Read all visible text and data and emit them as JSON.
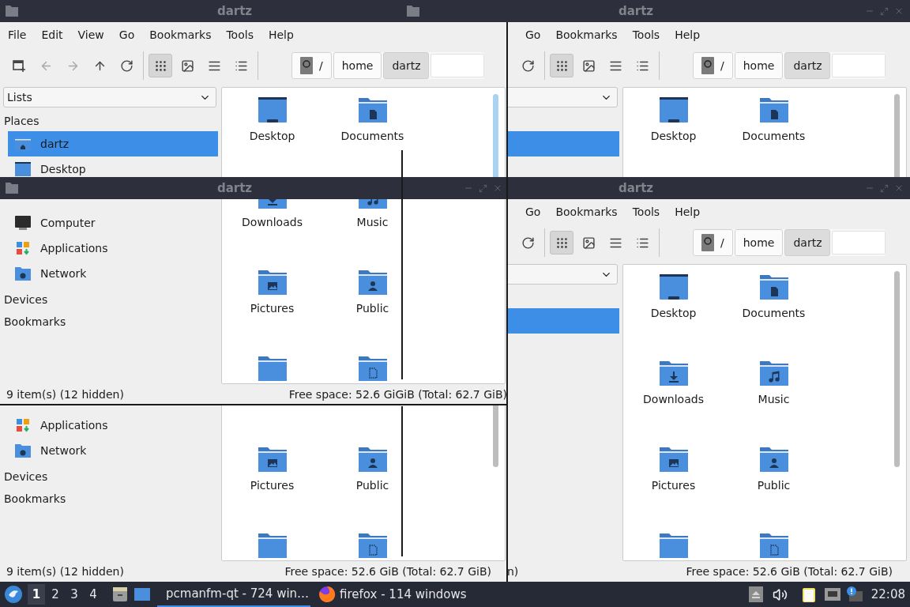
{
  "fragments": [
    {
      "kind": "title_bar",
      "title": "dartz"
    },
    {
      "kind": "title_bar",
      "title": "dartz",
      "window_controls": true
    },
    {
      "kind": "window_body",
      "menu": [
        "File",
        "Edit",
        "View",
        "Go",
        "Bookmarks",
        "Tools",
        "Help"
      ],
      "toolbar": [
        {
          "kind": "new_tab",
          "disabled": false
        },
        {
          "kind": "back",
          "disabled": true
        },
        {
          "kind": "forward",
          "disabled": true
        },
        {
          "kind": "up",
          "disabled": false
        },
        {
          "kind": "reload",
          "disabled": false
        },
        {
          "kind": "separator"
        },
        {
          "kind": "icon_view",
          "selected": true
        },
        {
          "kind": "thumbnail_view",
          "selected": false
        },
        {
          "kind": "compact_view",
          "selected": false
        },
        {
          "kind": "detail_view",
          "selected": false
        },
        {
          "kind": "separator"
        }
      ],
      "path": [
        {
          "kind": "root",
          "label": "/",
          "selected": false
        },
        {
          "kind": "dir",
          "label": "home",
          "selected": false
        },
        {
          "kind": "dir",
          "label": "dartz",
          "selected": true
        }
      ],
      "sidebar": [
        {
          "kind": "dropdown",
          "value": "Lists"
        },
        {
          "kind": "header",
          "label": "Places"
        },
        {
          "kind": "home",
          "label": "dartz",
          "selected": true
        },
        {
          "kind": "desktop",
          "label": "Desktop",
          "selected": false
        }
      ],
      "files": [
        {
          "kind": "desktop",
          "label": "Desktop"
        },
        {
          "kind": "documents",
          "label": "Documents"
        }
      ]
    },
    {
      "kind": "window_body",
      "menu": [
        "Go",
        "Bookmarks",
        "Tools",
        "Help"
      ],
      "toolbar": [
        {
          "kind": "reload",
          "disabled": false
        },
        {
          "kind": "separator"
        },
        {
          "kind": "icon_view",
          "selected": true
        },
        {
          "kind": "thumbnail_view",
          "selected": false
        },
        {
          "kind": "compact_view",
          "selected": false
        },
        {
          "kind": "detail_view",
          "selected": false
        },
        {
          "kind": "separator"
        }
      ],
      "path": [
        {
          "kind": "root",
          "label": "/",
          "selected": false
        },
        {
          "kind": "dir",
          "label": "home",
          "selected": false
        },
        {
          "kind": "dir",
          "label": "dartz",
          "selected": true
        }
      ],
      "sidebar": [
        {
          "kind": "dropdown"
        },
        {
          "kind": "header"
        },
        {
          "kind": "home",
          "selected": true
        }
      ],
      "files": [
        {
          "kind": "desktop",
          "label": "Desktop"
        },
        {
          "kind": "documents",
          "label": "Documents"
        }
      ]
    },
    {
      "kind": "title_bar",
      "title": "dartz",
      "window_controls": true
    },
    {
      "kind": "title_bar",
      "title": "dartz",
      "window_controls": true
    },
    {
      "kind": "window_body",
      "sidebar": [
        {
          "kind": "computer",
          "label": "Computer",
          "selected": false
        },
        {
          "kind": "applications",
          "label": "Applications",
          "selected": false
        },
        {
          "kind": "network",
          "label": "Network",
          "selected": false
        },
        {
          "kind": "header",
          "label": "Devices"
        },
        {
          "kind": "header",
          "label": "Bookmarks"
        }
      ],
      "files": [
        {
          "kind": "downloads",
          "label": "Downloads"
        },
        {
          "kind": "music",
          "label": "Music"
        },
        {
          "kind": "pictures",
          "label": "Pictures"
        },
        {
          "kind": "public",
          "label": "Public"
        },
        {
          "kind": "folder"
        },
        {
          "kind": "templates"
        }
      ],
      "status": {
        "left": "9 item(s) (12 hidden)",
        "right": [
          "Free space: 52.6 Gi",
          "GiB (Total: 62.7 GiB)"
        ]
      }
    },
    {
      "kind": "window_body",
      "sidebar": [
        {
          "kind": "applications",
          "label": "Applications",
          "selected": false
        },
        {
          "kind": "network",
          "label": "Network",
          "selected": false
        },
        {
          "kind": "header",
          "label": "Devices"
        },
        {
          "kind": "header",
          "label": "Bookmarks"
        }
      ],
      "files": [
        {
          "kind": "pictures",
          "label": "Pictures"
        },
        {
          "kind": "public",
          "label": "Public"
        },
        {
          "kind": "folder"
        },
        {
          "kind": "templates"
        }
      ],
      "status": {
        "left": "9 item(s) (12 hidden)",
        "right": [
          "Free space: 52.6 GiB (Total: 62.7 GiB)"
        ]
      }
    },
    {
      "kind": "window_body",
      "menu": [
        "Go",
        "Bookmarks",
        "Tools",
        "Help"
      ],
      "toolbar": [
        {
          "kind": "reload",
          "disabled": false
        },
        {
          "kind": "separator"
        },
        {
          "kind": "icon_view",
          "selected": true
        },
        {
          "kind": "thumbnail_view",
          "selected": false
        },
        {
          "kind": "compact_view",
          "selected": false
        },
        {
          "kind": "detail_view",
          "selected": false
        },
        {
          "kind": "separator"
        }
      ],
      "path": [
        {
          "kind": "root",
          "label": "/",
          "selected": false
        },
        {
          "kind": "dir",
          "label": "home",
          "selected": false
        },
        {
          "kind": "dir",
          "label": "dartz",
          "selected": true
        }
      ],
      "sidebar": [
        {
          "kind": "dropdown"
        },
        {
          "kind": "header"
        },
        {
          "kind": "home",
          "selected": true
        }
      ],
      "files": [
        {
          "kind": "desktop",
          "label": "Desktop"
        },
        {
          "kind": "documents",
          "label": "Documents"
        },
        {
          "kind": "downloads",
          "label": "Downloads"
        },
        {
          "kind": "music",
          "label": "Music"
        },
        {
          "kind": "pictures",
          "label": "Pictures"
        },
        {
          "kind": "public",
          "label": "Public"
        },
        {
          "kind": "folder"
        },
        {
          "kind": "templates"
        }
      ],
      "status": {
        "left": "n)",
        "right": [
          "Free space: 52.6 GiB (Total: 62.7 GiB)"
        ]
      }
    }
  ],
  "taskbar": {
    "workspaces": [
      {
        "label": "1",
        "selected": true
      },
      {
        "label": "2",
        "selected": false
      },
      {
        "label": "3",
        "selected": false
      },
      {
        "label": "4",
        "selected": false
      }
    ],
    "tasks": [
      {
        "kind": "files",
        "label": "pcmanfm-qt - 724 win…",
        "selected": true
      },
      {
        "kind": "browser",
        "label": "firefox - 114 windows",
        "selected": false
      }
    ],
    "clock": "22:08"
  }
}
